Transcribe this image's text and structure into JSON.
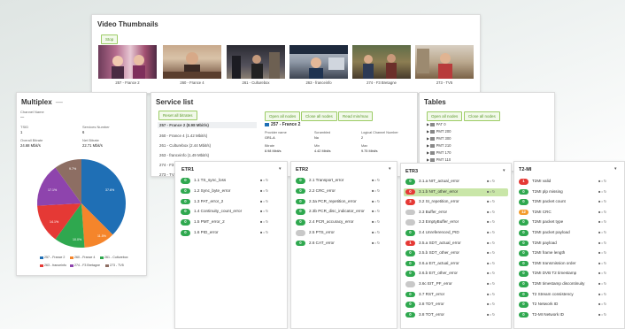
{
  "thumbnails": {
    "title": "Video Thumbnails",
    "stop_label": "Stop",
    "items": [
      {
        "caption": "257 - France 2"
      },
      {
        "caption": "260 - France 4"
      },
      {
        "caption": "261 - Culturebox"
      },
      {
        "caption": "263 - franceinfo"
      },
      {
        "caption": "274 - F3 Bretagne"
      },
      {
        "caption": "273 - TV5"
      }
    ]
  },
  "multiplex": {
    "title": "Multiplex",
    "title_suffix": "—",
    "channel_name_label": "Channel Name",
    "channel_name_value": "—",
    "tsid_label": "TSID",
    "tsid_value": "1",
    "services_label": "Services Number",
    "services_value": "6",
    "overall_label": "Overall Bitrate",
    "overall_value": "24.68 Mbit/s",
    "net_label": "Net Bitrate",
    "net_value": "22.71 Mbit/s",
    "pie_labels": [
      "37.6%",
      "11.5%",
      "10.0%",
      "14.1%",
      "17.1%",
      "9.7%"
    ],
    "legend": [
      "257 - France 2",
      "260 - France 4",
      "261 - Culturebox",
      "263 - franceinfo",
      "274 - F3 Bretagne",
      "273 - TV5"
    ],
    "colors": [
      "#1f6fb5",
      "#f5852b",
      "#2fa84f",
      "#e53935",
      "#8e44ad",
      "#8d6e63"
    ]
  },
  "service_list": {
    "title": "Service list",
    "reset_label": "Reset all bitrates",
    "items": [
      "257 - France 2 (8.98 Mbit/s)",
      "260 - France 4 (1.42 Mbit/s)",
      "261 - Culturebox (2.44 Mbit/s)",
      "263 - franceinfo (1.49 Mbit/s)",
      "274 - F3 ...",
      "273 - TV..."
    ],
    "open_all_label": "Open all nodes",
    "close_all_label": "Close all nodes",
    "read_more_label": "Read min/max",
    "detail_title": "257 - France 2",
    "provider_label": "Provider name",
    "provider_value": "GR1-A",
    "scrambled_label": "Scrambled",
    "scrambled_value": "No",
    "lcn_label": "Logical Channel Number",
    "lcn_value": "2",
    "bitrate_label": "Bitrate",
    "bitrate_value": "8.98 Mbit/s",
    "min_label": "Min",
    "min_value": "4.42 Mbit/s",
    "max_label": "Max",
    "max_value": "9.75 Mbit/s"
  },
  "tables": {
    "title": "Tables",
    "open_all_label": "Open all nodes",
    "close_all_label": "Close all nodes",
    "items": [
      "PAT 0",
      "PMT 200",
      "PMT 300",
      "PMT 210",
      "PMT 170",
      "PMT 110"
    ]
  },
  "etr1": {
    "title": "ETR1",
    "rows": [
      {
        "count": "0",
        "label": "1.1 TS_sync_loss",
        "status": "green"
      },
      {
        "count": "0",
        "label": "1.2 Sync_byte_error",
        "status": "green"
      },
      {
        "count": "0",
        "label": "1.3 PAT_error_2",
        "status": "green"
      },
      {
        "count": "0",
        "label": "1.4 Continuity_count_error",
        "status": "green"
      },
      {
        "count": "0",
        "label": "1.5 PMT_error_2",
        "status": "green"
      },
      {
        "count": "0",
        "label": "1.6 PID_error",
        "status": "green"
      }
    ]
  },
  "etr2": {
    "title": "ETR2",
    "rows": [
      {
        "count": "0",
        "label": "2.1 Transport_error",
        "status": "green"
      },
      {
        "count": "0",
        "label": "2.2 CRC_error",
        "status": "green"
      },
      {
        "count": "0",
        "label": "2.3a PCR_repetition_error",
        "status": "green"
      },
      {
        "count": "0",
        "label": "2.3b PCR_disc_indicator_error",
        "status": "green"
      },
      {
        "count": "0",
        "label": "2.4 PCR_accuracy_error",
        "status": "green"
      },
      {
        "count": "",
        "label": "2.5 PTS_error",
        "status": "grey"
      },
      {
        "count": "0",
        "label": "2.6 CAT_error",
        "status": "green"
      }
    ]
  },
  "etr3": {
    "title": "ETR3",
    "rows": [
      {
        "count": "0",
        "label": "3.1.a NIT_actual_error",
        "status": "green"
      },
      {
        "count": "0",
        "label": "3.1.b NIT_other_error",
        "status": "red"
      },
      {
        "count": "3",
        "label": "3.2 SI_repetition_error",
        "status": "red"
      },
      {
        "count": "",
        "label": "3.3 Buffer_error",
        "status": "grey"
      },
      {
        "count": "",
        "label": "3.3 EmptyBuffer_error",
        "status": "grey"
      },
      {
        "count": "0",
        "label": "3.4 Unreferenced_PID",
        "status": "green"
      },
      {
        "count": "1",
        "label": "3.5.a SDT_actual_error",
        "status": "red"
      },
      {
        "count": "0",
        "label": "3.5.b SDT_other_error",
        "status": "green"
      },
      {
        "count": "0",
        "label": "3.6.a EIT_actual_error",
        "status": "green"
      },
      {
        "count": "0",
        "label": "3.6.b EIT_other_error",
        "status": "green"
      },
      {
        "count": "",
        "label": "3.6c EIT_PF_error",
        "status": "grey"
      },
      {
        "count": "0",
        "label": "3.7 RST_error",
        "status": "green"
      },
      {
        "count": "0",
        "label": "3.8 TDT_error",
        "status": "green"
      },
      {
        "count": "0",
        "label": "3.8 TOT_error",
        "status": "green"
      }
    ]
  },
  "t2mi": {
    "title": "T2-MI",
    "rows": [
      {
        "count": "1",
        "label": "T2MI valid",
        "status": "red"
      },
      {
        "count": "0",
        "label": "T2MI plp missing",
        "status": "green"
      },
      {
        "count": "0",
        "label": "T2MI packet count",
        "status": "green"
      },
      {
        "count": "12",
        "label": "T2MI CRC",
        "status": "orange"
      },
      {
        "count": "0",
        "label": "T2MI packet type",
        "status": "green"
      },
      {
        "count": "0",
        "label": "T2MI packet payload",
        "status": "green"
      },
      {
        "count": "0",
        "label": "T2MI payload",
        "status": "green"
      },
      {
        "count": "0",
        "label": "T2MI frame length",
        "status": "green"
      },
      {
        "count": "0",
        "label": "T2MI transmission order",
        "status": "green"
      },
      {
        "count": "0",
        "label": "T2MI DVB T2 timestamp",
        "status": "green"
      },
      {
        "count": "0",
        "label": "T2MI timestamp discontinuity",
        "status": "green"
      },
      {
        "count": "0",
        "label": "T2 Stream consistency",
        "status": "green"
      },
      {
        "count": "0",
        "label": "T2 Network ID",
        "status": "green"
      },
      {
        "count": "0",
        "label": "T2-MI Network ID",
        "status": "green"
      }
    ]
  }
}
